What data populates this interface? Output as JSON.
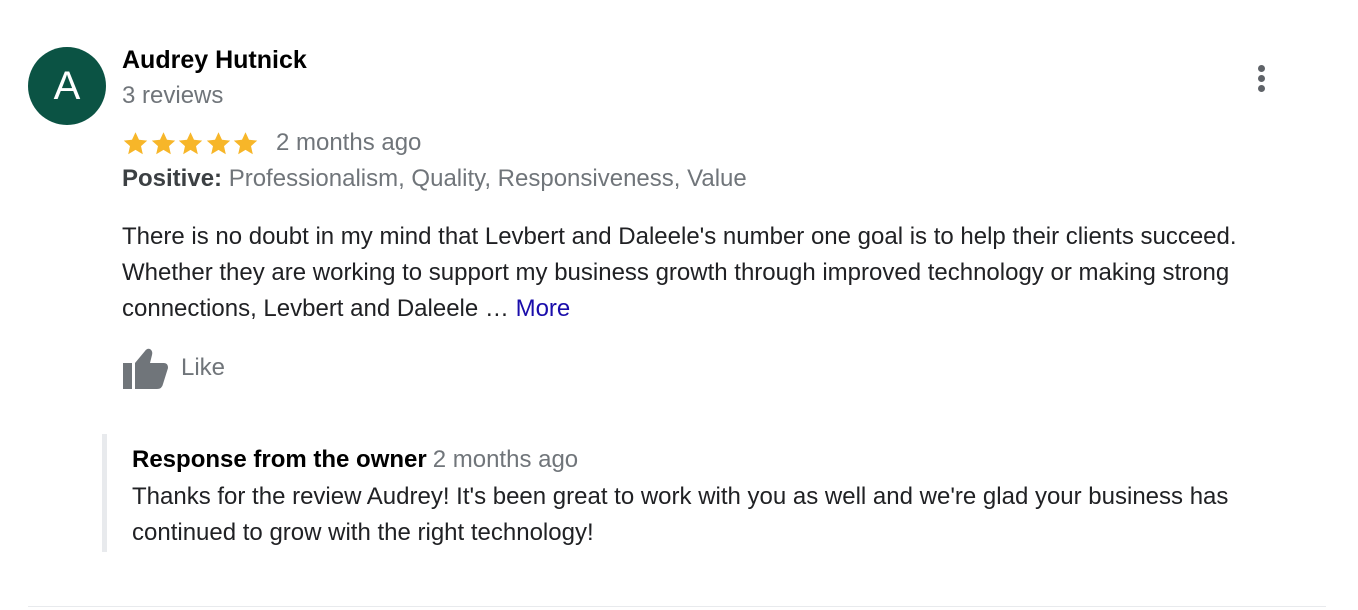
{
  "reviewer": {
    "avatar_letter": "A",
    "avatar_color": "#0b5344",
    "name": "Audrey Hutnick",
    "meta": "3 reviews"
  },
  "review": {
    "rating": 5,
    "rating_max": 5,
    "date": "2 months ago",
    "attributes_label": "Positive:",
    "attributes_values": " Professionalism, Quality, Responsiveness, Value",
    "text": "There is no doubt in my mind that Levbert and Daleele's number one goal is to help their clients succeed. Whether they are working to support my business growth through improved technology or making strong connections, Levbert and Daleele … ",
    "more_label": "More",
    "star_color": "#f7b629"
  },
  "actions": {
    "like_label": "Like",
    "menu_icon": "more-vert-icon"
  },
  "owner_response": {
    "title": "Response from the owner",
    "date": "2 months ago",
    "text": "Thanks for the review Audrey! It's been great to work with you as well and we're glad your business has continued to grow with the right technology!"
  }
}
